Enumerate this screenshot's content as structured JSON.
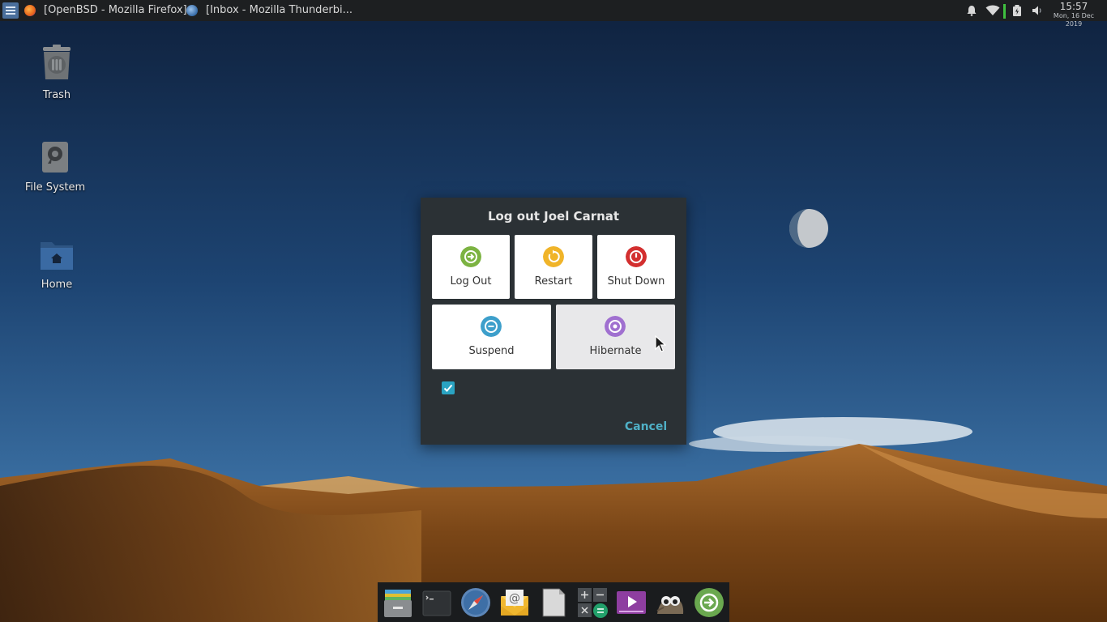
{
  "panel": {
    "tasks": [
      {
        "label": "[OpenBSD - Mozilla Firefox]",
        "icon": "firefox-icon"
      },
      {
        "label": "[Inbox - Mozilla Thunderbi...",
        "icon": "thunderbird-icon"
      }
    ],
    "tray_icons": [
      "bell-icon",
      "wifi-icon",
      "battery-icon",
      "volume-icon"
    ],
    "clock": {
      "time": "15:57",
      "date": "Mon, 16 Dec 2019"
    }
  },
  "desktop": {
    "icons": [
      {
        "label": "Trash",
        "icon": "trash-icon"
      },
      {
        "label": "File System",
        "icon": "drive-icon"
      },
      {
        "label": "Home",
        "icon": "home-folder-icon"
      }
    ]
  },
  "dialog": {
    "title": "Log out Joel Carnat",
    "actions": [
      {
        "label": "Log Out",
        "icon": "logout-icon",
        "color": "#7cb342"
      },
      {
        "label": "Restart",
        "icon": "restart-icon",
        "color": "#f0b429"
      },
      {
        "label": "Shut Down",
        "icon": "power-icon",
        "color": "#d32f2f"
      },
      {
        "label": "Suspend",
        "icon": "suspend-icon",
        "color": "#3d9fcb"
      },
      {
        "label": "Hibernate",
        "icon": "hibernate-icon",
        "color": "#a070d0"
      }
    ],
    "save_session_checked": true,
    "cancel_label": "Cancel"
  },
  "dock": {
    "items": [
      "file-manager-icon",
      "terminal-icon",
      "web-browser-icon",
      "mail-icon",
      "document-icon",
      "calculator-icon",
      "media-player-icon",
      "gimp-icon",
      "logout-app-icon"
    ]
  },
  "colors": {
    "accent": "#2aa3c2",
    "dialog_bg": "#2b3135",
    "panel_bg": "#1d1f21"
  }
}
